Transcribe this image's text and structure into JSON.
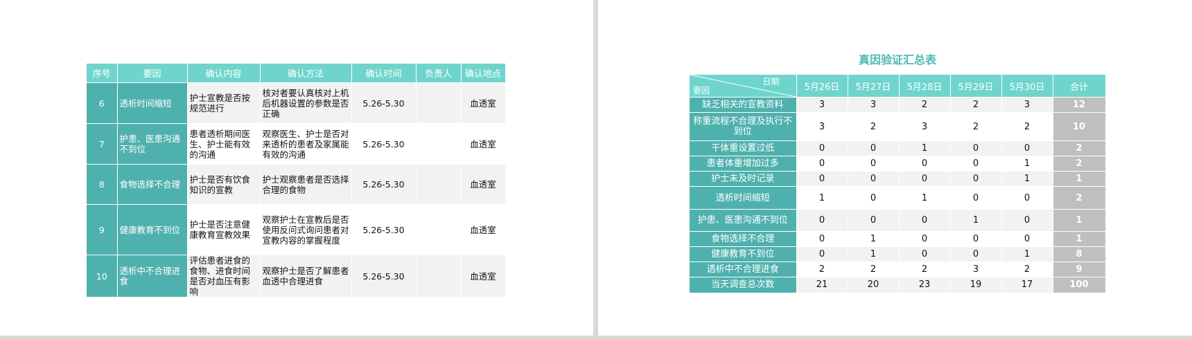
{
  "left_table": {
    "headers": [
      "序号",
      "要因",
      "确认内容",
      "确认方法",
      "确认时间",
      "负责人",
      "确认地点"
    ],
    "rows": [
      {
        "no": "6",
        "cause": "透析时间缩短",
        "content": "护士宣教是否按规范进行",
        "method": "核对者要认真核对上机后机器设置的参数是否正确",
        "time": "5.26-5.30",
        "person": "",
        "place": "血透室"
      },
      {
        "no": "7",
        "cause": "护患、医患沟通不到位",
        "content": "患者透析期间医生、护士能有效的沟通",
        "method": "观察医生、护士是否对来透析的患者及家属能有效的沟通",
        "time": "5.26-5.30",
        "person": "",
        "place": "血透室"
      },
      {
        "no": "8",
        "cause": "食物选择不合理",
        "content": "护士是否有饮食知识的宣教",
        "method": "护士观察患者是否选择合理的食物",
        "time": "5.26-5.30",
        "person": "",
        "place": "血透室"
      },
      {
        "no": "9",
        "cause": "健康教育不到位",
        "content": "护士是否注意健康教育宣教效果",
        "method": "观察护士在宣教后是否使用反问式询问患者对宣教内容的掌握程度",
        "time": "5.26-5.30",
        "person": "",
        "place": "血透室"
      },
      {
        "no": "10",
        "cause": "透析中不合理进食",
        "content": "评估患者进食的食物、进食时间是否对血压有影响",
        "method": "观察护士是否了解患者血透中合理进食",
        "time": "5.26-5.30",
        "person": "",
        "place": "血透室"
      }
    ]
  },
  "right_table": {
    "title": "真因验证汇总表",
    "corner_top": "日期",
    "corner_bottom": "要因",
    "date_headers": [
      "5月26日",
      "5月27日",
      "5月28日",
      "5月29日",
      "5月30日"
    ],
    "total_header": "合计",
    "rows": [
      {
        "label": "缺乏相关的宣教资料",
        "values": [
          "3",
          "3",
          "2",
          "2",
          "3"
        ],
        "total": "12"
      },
      {
        "label": "称重流程不合理及执行不到位",
        "values": [
          "3",
          "2",
          "3",
          "2",
          "2"
        ],
        "total": "10"
      },
      {
        "label": "干体重设置过低",
        "values": [
          "0",
          "0",
          "1",
          "0",
          "0"
        ],
        "total": "2"
      },
      {
        "label": "患者体重增加过多",
        "values": [
          "0",
          "0",
          "0",
          "0",
          "1"
        ],
        "total": "2"
      },
      {
        "label": "护士未及时记录",
        "values": [
          "0",
          "0",
          "0",
          "0",
          "1"
        ],
        "total": "1"
      },
      {
        "label": "透析时间缩短",
        "values": [
          "1",
          "0",
          "1",
          "0",
          "0"
        ],
        "total": "2"
      },
      {
        "label": "护患、医患沟通不到位",
        "values": [
          "0",
          "0",
          "0",
          "1",
          "0"
        ],
        "total": "1"
      },
      {
        "label": "食物选择不合理",
        "values": [
          "0",
          "1",
          "0",
          "0",
          "0"
        ],
        "total": "1"
      },
      {
        "label": "健康教育不到位",
        "values": [
          "0",
          "1",
          "0",
          "0",
          "1"
        ],
        "total": "8"
      },
      {
        "label": "透析中不合理进食",
        "values": [
          "2",
          "2",
          "2",
          "3",
          "2"
        ],
        "total": "9"
      },
      {
        "label": "当天调查总次数",
        "values": [
          "21",
          "20",
          "23",
          "19",
          "17"
        ],
        "total": "100"
      }
    ]
  },
  "colors": {
    "header_teal": "#6fd5cc",
    "label_teal": "#4fb1ad",
    "title_teal": "#4fb8b3",
    "total_gray": "#bfbfbf"
  }
}
